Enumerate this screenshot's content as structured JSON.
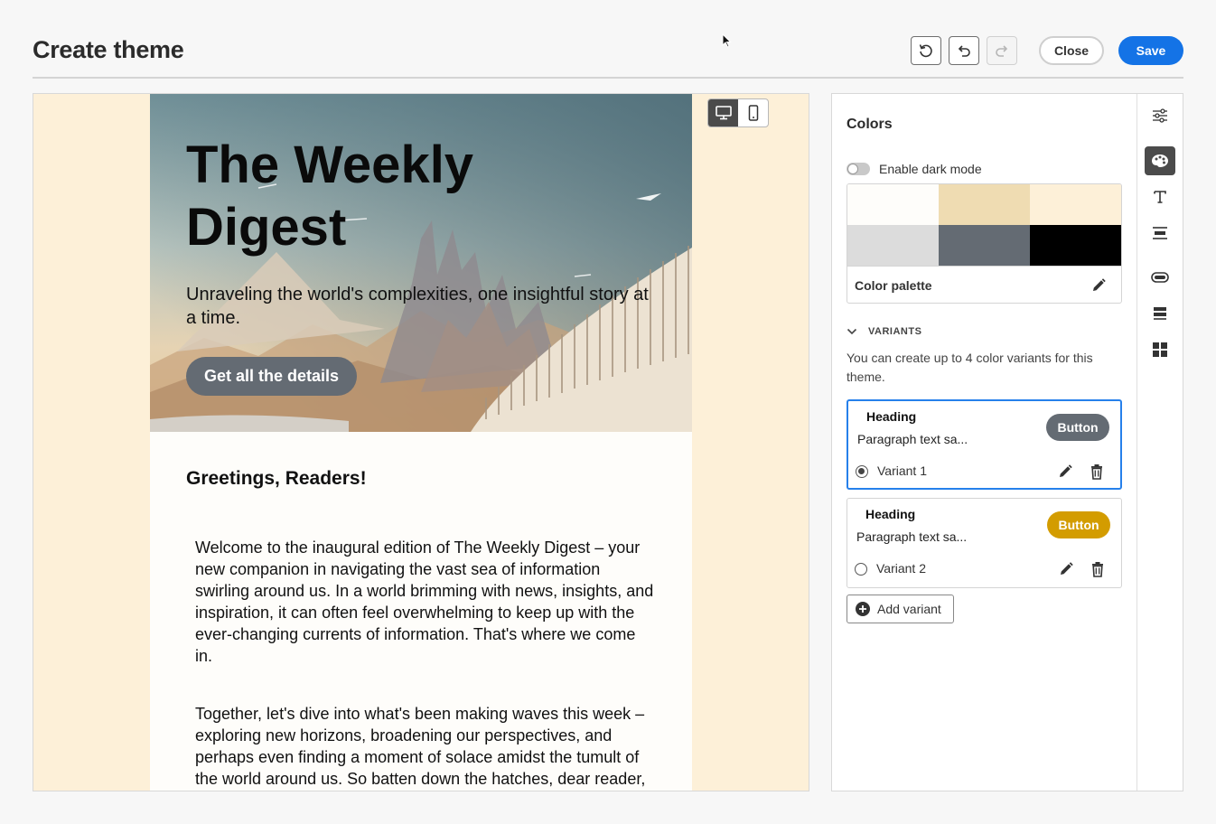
{
  "header": {
    "title": "Create theme",
    "close_label": "Close",
    "save_label": "Save",
    "accent_color": "#1473e6"
  },
  "canvas": {
    "background_color": "#fdf0d8",
    "device_toggle": {
      "options": [
        "desktop",
        "mobile"
      ],
      "selected": "desktop"
    }
  },
  "email": {
    "hero_title": "The Weekly Digest",
    "hero_subtitle": "Unraveling the world's complexities, one insightful story at a time.",
    "hero_button": "Get all the details",
    "greeting": "Greetings, Readers!",
    "paragraphs": [
      "Welcome to the inaugural edition of The Weekly Digest – your new companion in navigating the vast sea of information swirling around us. In a world brimming with news, insights, and inspiration, it can often feel overwhelming to keep up with the ever-changing currents of information. That's where we come in.",
      "Together, let's dive into what's been making waves this week – exploring new horizons, broadening our perspectives, and perhaps even finding a moment of solace amidst the tumult of the world around us. So batten down the hatches, dear reader,"
    ]
  },
  "panel": {
    "title": "Colors",
    "dark_mode_label": "Enable dark mode",
    "dark_mode_enabled": false,
    "palette_label": "Color palette",
    "palette_colors": [
      "#fefdfa",
      "#efdcb2",
      "#fdf0d8",
      "#dcdcdc",
      "#646b73",
      "#000000"
    ],
    "variants_label": "VARIANTS",
    "variants_description": "You can create up to 4 color variants for this theme.",
    "variants": [
      {
        "heading": "Heading",
        "paragraph": "Paragraph text sa...",
        "button": "Button",
        "button_color": "#646b73",
        "name": "Variant 1",
        "selected": true
      },
      {
        "heading": "Heading",
        "paragraph": "Paragraph text sa...",
        "button": "Button",
        "button_color": "#d39c00",
        "name": "Variant 2",
        "selected": false
      }
    ],
    "add_variant_label": "Add variant"
  },
  "rail": {
    "items": [
      "settings-icon",
      "palette-icon",
      "text-icon",
      "spacing-icon",
      "button-icon",
      "layout-icon",
      "components-icon"
    ],
    "active": "palette-icon"
  }
}
